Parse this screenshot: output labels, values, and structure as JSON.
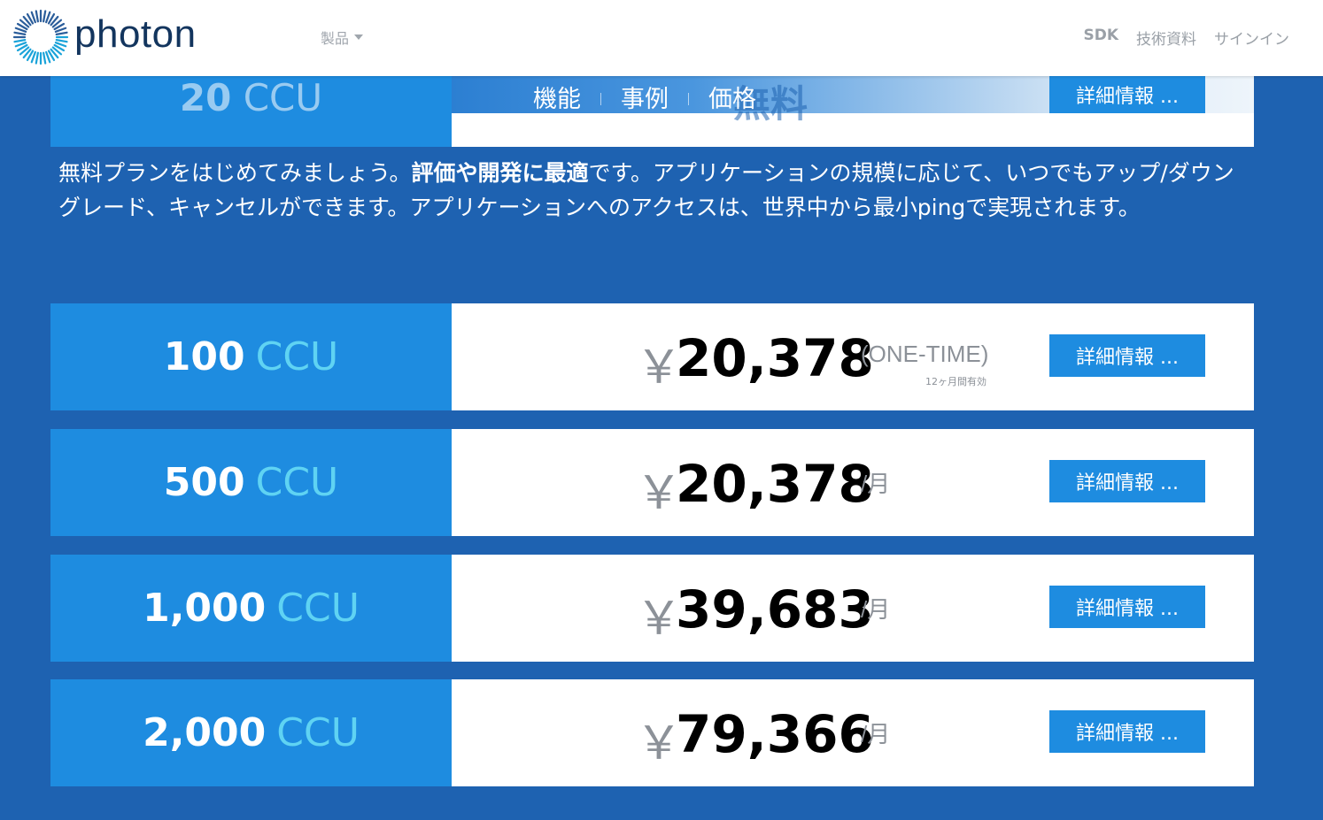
{
  "header": {
    "logo_text": "photon",
    "products_label": "製品",
    "nav_right": [
      "SDK",
      "技術資料",
      "サインイン"
    ]
  },
  "subnav": {
    "tabs": [
      "機能",
      "事例",
      "価格"
    ],
    "ghost_text": "無料"
  },
  "top_plan": {
    "ccu_number": "20",
    "ccu_unit": "CCU",
    "button_label": "詳細情報 ..."
  },
  "description": {
    "part1": "無料プランをはじめてみましょう。",
    "bold": "評価や開発に最適",
    "part2": "です。アプリケーションの規模に応じて、いつでもアップ/ダウングレード、キャンセルができます。アプリケーションへのアクセスは、世界中から最小pingで実現されます。"
  },
  "plans": [
    {
      "ccu_number": "100",
      "ccu_unit": "CCU",
      "currency": "￥",
      "price": "20,378",
      "period": "(ONE-TIME)",
      "note": "12ヶ月間有効",
      "button_label": "詳細情報 ..."
    },
    {
      "ccu_number": "500",
      "ccu_unit": "CCU",
      "currency": "￥",
      "price": "20,378",
      "period": "/月",
      "note": "",
      "button_label": "詳細情報 ..."
    },
    {
      "ccu_number": "1,000",
      "ccu_unit": "CCU",
      "currency": "￥",
      "price": "39,683",
      "period": "/月",
      "note": "",
      "button_label": "詳細情報 ..."
    },
    {
      "ccu_number": "2,000",
      "ccu_unit": "CCU",
      "currency": "￥",
      "price": "79,366",
      "period": "/月",
      "note": "",
      "button_label": "詳細情報 ..."
    }
  ],
  "colors": {
    "page_bg": "#1e62b1",
    "ccu_box": "#1e8ce0",
    "ccu_unit": "#5fd3f3",
    "button": "#1e8ce0",
    "logo_text": "#13355e"
  }
}
